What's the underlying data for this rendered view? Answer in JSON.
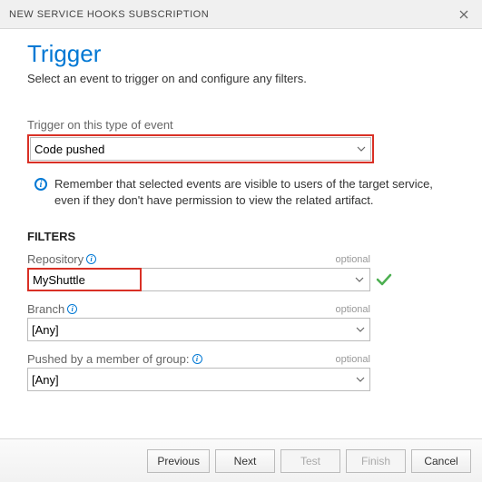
{
  "dialog": {
    "title": "NEW SERVICE HOOKS SUBSCRIPTION"
  },
  "page": {
    "heading": "Trigger",
    "subtext": "Select an event to trigger on and configure any filters."
  },
  "event": {
    "label": "Trigger on this type of event",
    "value": "Code pushed"
  },
  "info": {
    "text": "Remember that selected events are visible to users of the target service, even if they don't have permission to view the related artifact."
  },
  "filters": {
    "header": "FILTERS",
    "repository": {
      "label": "Repository",
      "optional": "optional",
      "value": "MyShuttle"
    },
    "branch": {
      "label": "Branch",
      "optional": "optional",
      "value": "[Any]"
    },
    "group": {
      "label": "Pushed by a member of group:",
      "optional": "optional",
      "value": "[Any]"
    }
  },
  "buttons": {
    "previous": "Previous",
    "next": "Next",
    "test": "Test",
    "finish": "Finish",
    "cancel": "Cancel"
  }
}
